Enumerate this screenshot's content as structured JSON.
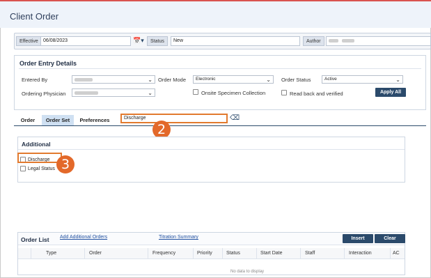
{
  "window": {
    "title": "Client Order"
  },
  "effective": {
    "effective_label": "Effective",
    "effective_value": "06/08/2023",
    "status_label": "Status",
    "status_value": "New",
    "author_label": "Author"
  },
  "order_entry": {
    "title": "Order Entry Details",
    "entered_by_label": "Entered By",
    "order_mode_label": "Order Mode",
    "order_mode_value": "Electronic",
    "order_status_label": "Order Status",
    "order_status_value": "Active",
    "ordering_physician_label": "Ordering Physician",
    "onsite_label": "Onsite Specimen Collection",
    "read_back_label": "Read back and verified",
    "apply_all_label": "Apply All"
  },
  "tabs": [
    {
      "label": "Order"
    },
    {
      "label": "Order Set"
    },
    {
      "label": "Preferences"
    }
  ],
  "search": {
    "value": "Discharge"
  },
  "callouts": {
    "step_search": "2",
    "step_item": "3"
  },
  "additional": {
    "title": "Additional",
    "items": [
      {
        "label": "Discharge",
        "checked": false
      },
      {
        "label": "Legal Status",
        "checked": false
      }
    ]
  },
  "order_list": {
    "title": "Order List",
    "add_link": "Add Additional Orders",
    "titration_link": "Titration Summary",
    "insert_label": "Insert",
    "clear_label": "Clear",
    "columns": [
      "Type",
      "Order",
      "Frequency",
      "Priority",
      "Status",
      "Start Date",
      "Staff",
      "Interaction",
      "AC"
    ],
    "empty_text": "No data to display"
  },
  "colors": {
    "accent": "#2b4a6b",
    "highlight": "#e27a2e",
    "tab_active": "#cfe0f2",
    "topbar_line": "#d9534f"
  }
}
